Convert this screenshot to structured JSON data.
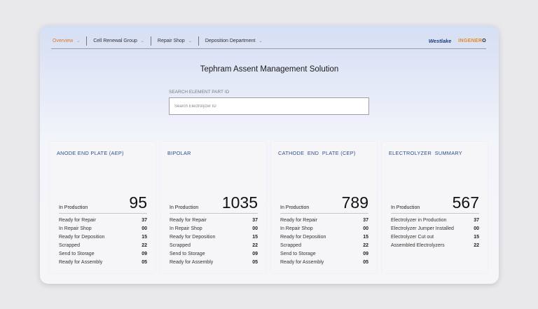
{
  "nav": {
    "items": [
      {
        "label": "Overview"
      },
      {
        "label": "Cell Renewal Group"
      },
      {
        "label": "Repair Shop"
      },
      {
        "label": "Deposition Department"
      }
    ],
    "logos": {
      "westlake": "Westlake",
      "ingenero_main": "INGENER",
      "ingenero_tail": "O"
    }
  },
  "title": "Tephram Assent Management Solution",
  "search": {
    "label": "SEARCH ELEMENT PART ID",
    "placeholder": "Search Electrolyzer ID",
    "value": ""
  },
  "colors": {
    "accent": "#d97a2b",
    "card_title": "#2f4f8f"
  },
  "cards": [
    {
      "title": "ANODE END PLATE (AEP)",
      "production_label": "In Production",
      "production_value": "95",
      "rows": [
        {
          "label": "Ready for Repair",
          "value": "37"
        },
        {
          "label": "In Repair Shop",
          "value": "00"
        },
        {
          "label": "Ready for Deposition",
          "value": "15"
        },
        {
          "label": "Scrapped",
          "value": "22"
        },
        {
          "label": "Send to Storage",
          "value": "09"
        },
        {
          "label": "Ready for Assembly",
          "value": "05"
        }
      ]
    },
    {
      "title": "BIPOLAR",
      "production_label": "In Production",
      "production_value": "1035",
      "rows": [
        {
          "label": "Ready for Repair",
          "value": "37"
        },
        {
          "label": "In Repair Shop",
          "value": "00"
        },
        {
          "label": "Ready for Deposition",
          "value": "15"
        },
        {
          "label": "Scrapped",
          "value": "22"
        },
        {
          "label": "Send to Storage",
          "value": "09"
        },
        {
          "label": "Ready for Assembly",
          "value": "05"
        }
      ]
    },
    {
      "title": "CATHODE  END  PLATE (CEP)",
      "production_label": "In Production",
      "production_value": "789",
      "rows": [
        {
          "label": "Ready for Repair",
          "value": "37"
        },
        {
          "label": "In Repair Shop",
          "value": "00"
        },
        {
          "label": "Ready for Deposition",
          "value": "15"
        },
        {
          "label": "Scrapped",
          "value": "22"
        },
        {
          "label": "Send to Storage",
          "value": "09"
        },
        {
          "label": "Ready for Assembly",
          "value": "05"
        }
      ]
    },
    {
      "title": "ELECTROLYZER  SUMMARY",
      "production_label": "In Production",
      "production_value": "567",
      "rows": [
        {
          "label": "Electrolyzer in Production",
          "value": "37"
        },
        {
          "label": "Electrolyzer Jumper Installed",
          "value": "00"
        },
        {
          "label": "Electrolyzer Cut out",
          "value": "15"
        },
        {
          "label": "Assembled Electrolyzers",
          "value": "22"
        }
      ]
    }
  ]
}
